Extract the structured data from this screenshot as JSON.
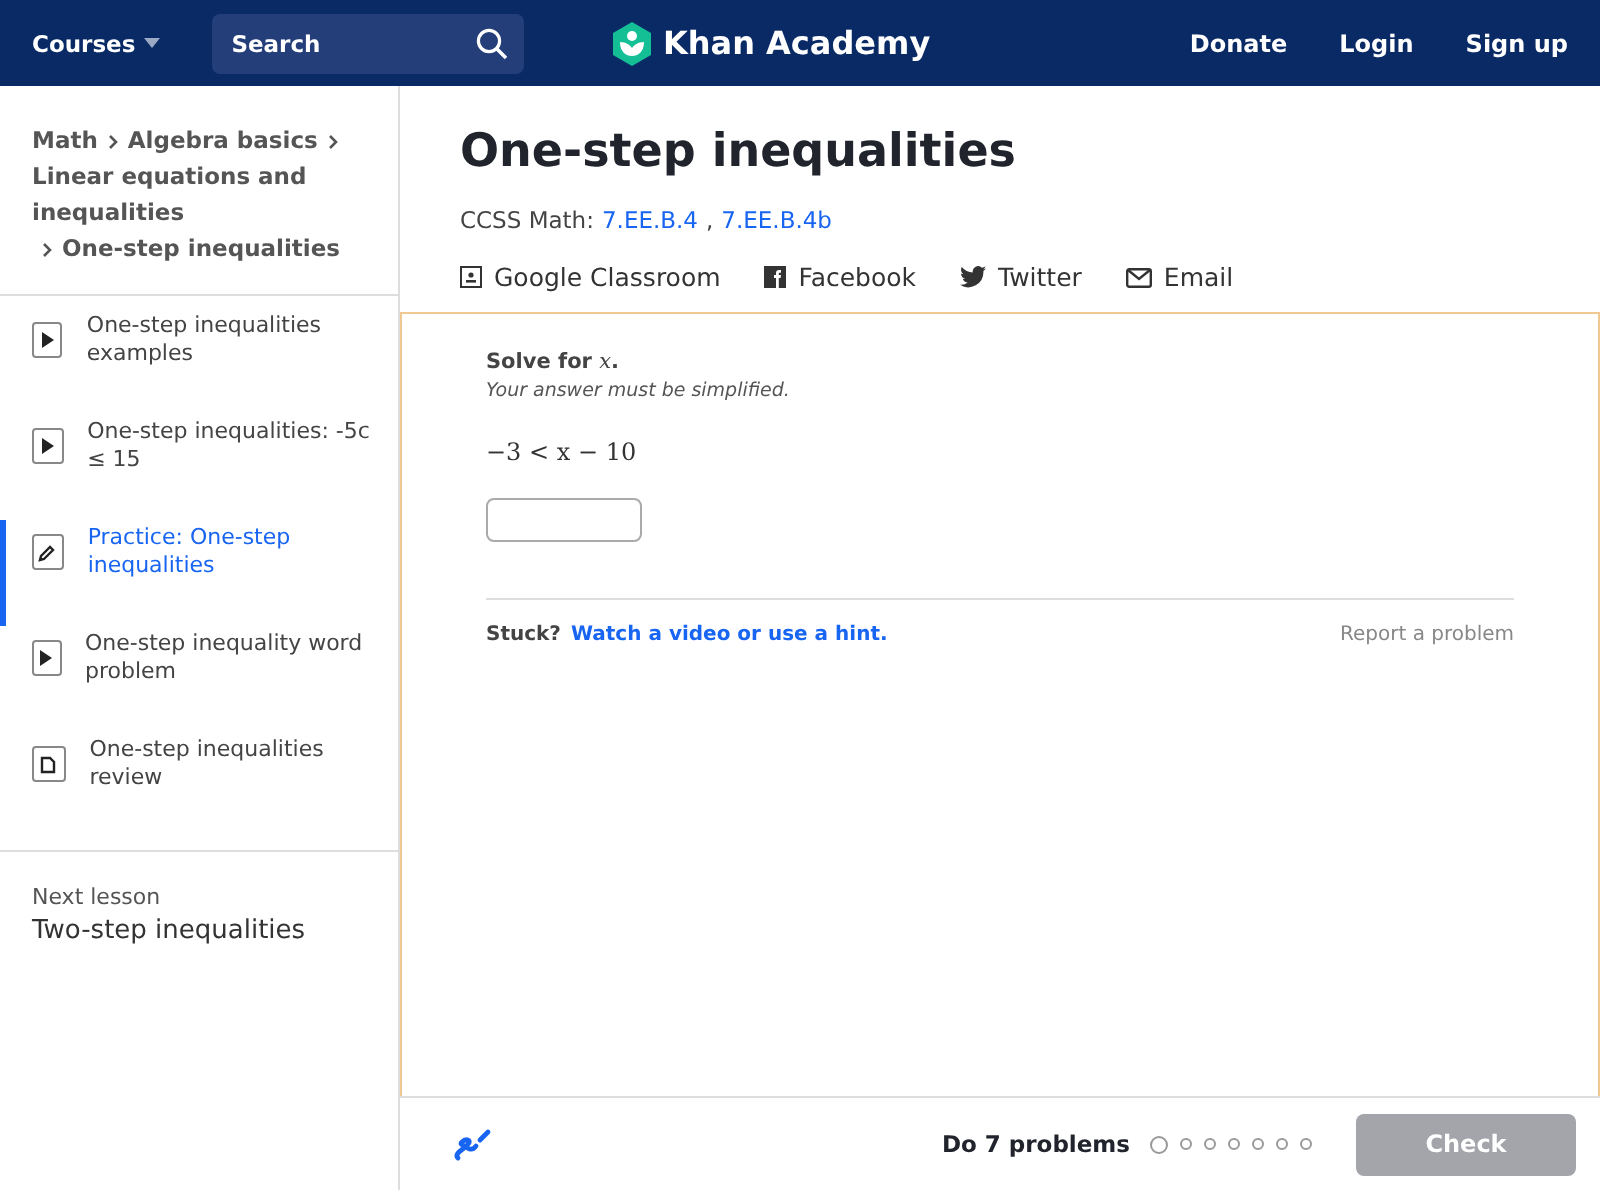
{
  "header": {
    "courses": "Courses",
    "search": {
      "placeholder": "Search"
    },
    "logo": "Khan Academy",
    "links": [
      "Donate",
      "Login",
      "Sign up"
    ]
  },
  "sidebar": {
    "breadcrumbs": [
      "Math",
      "Algebra basics",
      "Linear equations and inequalities",
      "One-step inequalities"
    ],
    "items": [
      {
        "kind": "video",
        "label": "One-step inequalities examples",
        "selected": false
      },
      {
        "kind": "video",
        "label": "One-step inequalities: -5c ≤ 15",
        "selected": false
      },
      {
        "kind": "exercise",
        "label": "Practice: One-step inequalities",
        "selected": true
      },
      {
        "kind": "video",
        "label": "One-step inequality word problem",
        "selected": false
      },
      {
        "kind": "article",
        "label": "One-step inequalities review",
        "selected": false
      }
    ],
    "next_lesson": {
      "label": "Next lesson",
      "title": "Two-step inequalities"
    }
  },
  "main": {
    "title": "One-step inequalities",
    "standards_label": "CCSS Math:",
    "standards": [
      "7.EE.B.4",
      "7.EE.B.4b"
    ],
    "standards_separator": ",",
    "share": [
      {
        "kind": "classroom",
        "label": "Google Classroom"
      },
      {
        "kind": "facebook",
        "label": "Facebook"
      },
      {
        "kind": "twitter",
        "label": "Twitter"
      },
      {
        "kind": "email",
        "label": "Email"
      }
    ],
    "problem": {
      "prompt": "Solve for",
      "variable": "x",
      "prompt_end": ".",
      "note": "Your answer must be simplified.",
      "expression": "−3 < x − 10",
      "stuck": "Stuck?",
      "hint_link": "Watch a video or use a hint.",
      "report": "Report a problem"
    }
  },
  "footer": {
    "task": "Do 7 problems",
    "dots": [
      {
        "selected": true
      },
      {
        "selected": false
      },
      {
        "selected": false
      },
      {
        "selected": false
      },
      {
        "selected": false
      },
      {
        "selected": false
      },
      {
        "selected": false
      }
    ],
    "check": {
      "label": "Check",
      "disabled": true
    }
  }
}
